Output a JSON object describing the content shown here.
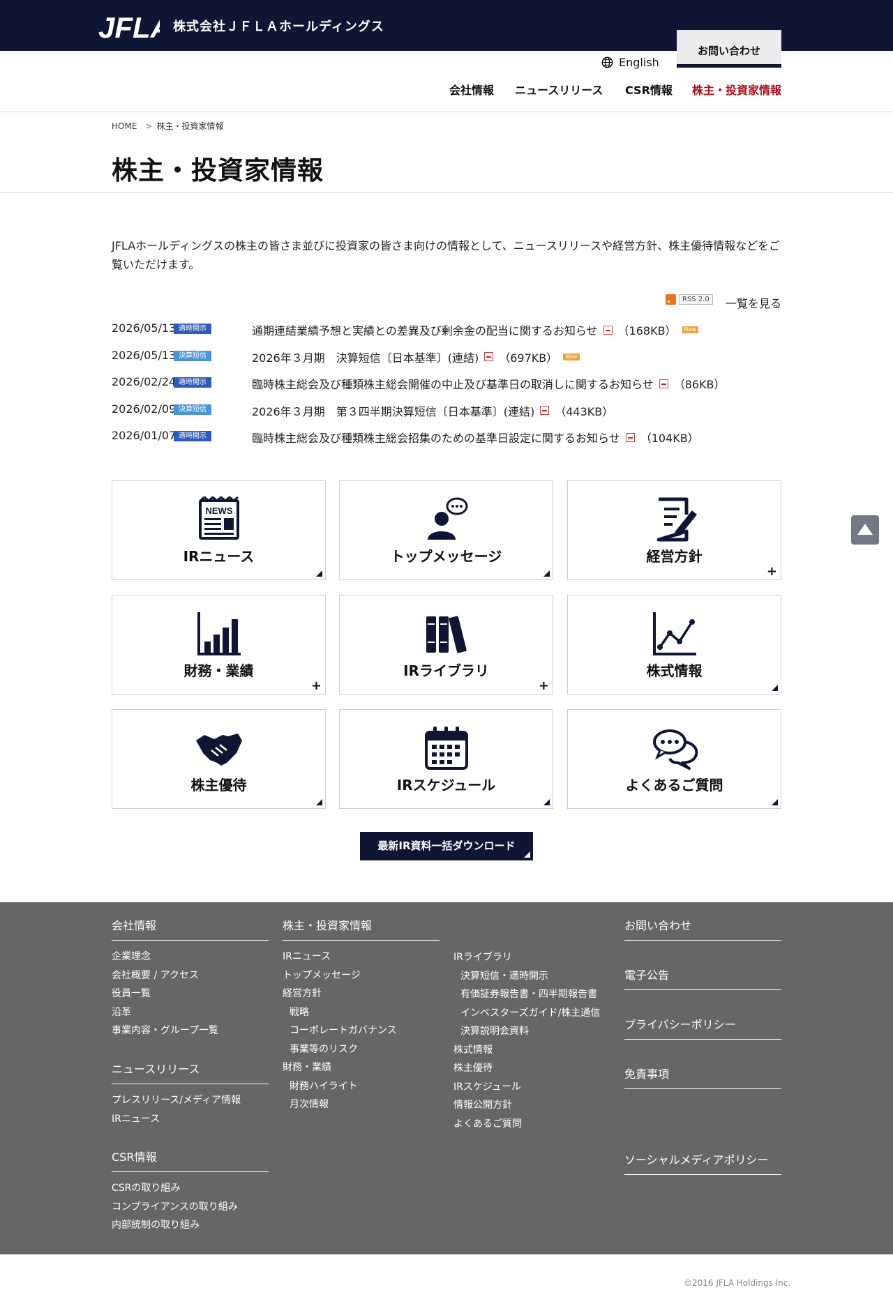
{
  "header": {
    "logo_text": "JFLA",
    "company_name": "株式会社ＪＦＬＡホールディングス",
    "contact_label": "お問い合わせ",
    "english_label": "English",
    "nav": [
      {
        "label": "会社情報",
        "active": false
      },
      {
        "label": "ニュースリリース",
        "active": false
      },
      {
        "label": "CSR情報",
        "active": false
      },
      {
        "label": "株主・投資家情報",
        "active": true
      }
    ]
  },
  "breadcrumb": {
    "home": "HOME",
    "sep": ">",
    "current": "株主・投資家情報"
  },
  "page": {
    "title": "株主・投資家情報",
    "intro": "JFLAホールディングスの株主の皆さま並びに投資家の皆さま向けの情報として、ニュースリリースや経営方針、株主優待情報などをご覧いただけます。"
  },
  "feed": {
    "rss_label": "RSS 2.0",
    "all_label": "一覧を見る"
  },
  "news": [
    {
      "date": "2026/05/13",
      "tag": "適時開示",
      "tag_color": "#2f5cb8",
      "title": "通期連結業績予想と実績との差異及び剰余金の配当に関するお知らせ",
      "size": "（168KB）",
      "new_label": "New"
    },
    {
      "date": "2026/05/13",
      "tag": "決算短信",
      "tag_color": "#4a95d6",
      "title": "2026年３月期　決算短信〔日本基準〕(連結)",
      "size": "（697KB）",
      "new_label": "New"
    },
    {
      "date": "2026/02/24",
      "tag": "適時開示",
      "tag_color": "#2f5cb8",
      "title": "臨時株主総会及び種類株主総会開催の中止及び基準日の取消しに関するお知らせ",
      "size": "（86KB）",
      "new_label": ""
    },
    {
      "date": "2026/02/09",
      "tag": "決算短信",
      "tag_color": "#4a95d6",
      "title": "2026年３月期　第３四半期決算短信〔日本基準〕(連結)",
      "size": "（443KB）",
      "new_label": ""
    },
    {
      "date": "2026/01/07",
      "tag": "適時開示",
      "tag_color": "#2f5cb8",
      "title": "臨時株主総会及び種類株主総会招集のための基準日設定に関するお知らせ",
      "size": "（104KB）",
      "new_label": ""
    }
  ],
  "tiles": [
    {
      "label": "IRニュース",
      "icon": "news-icon",
      "marker": "arrow",
      "icon_text": "NEWS"
    },
    {
      "label": "トップメッセージ",
      "icon": "speaker-icon",
      "marker": "arrow"
    },
    {
      "label": "経営方針",
      "icon": "document-pen-icon",
      "marker": "plus"
    },
    {
      "label": "財務・業績",
      "icon": "bar-chart-icon",
      "marker": "plus"
    },
    {
      "label": "IRライブラリ",
      "icon": "books-icon",
      "marker": "plus"
    },
    {
      "label": "株式情報",
      "icon": "line-chart-icon",
      "marker": "arrow"
    },
    {
      "label": "株主優待",
      "icon": "handshake-icon",
      "marker": "arrow"
    },
    {
      "label": "IRスケジュール",
      "icon": "calendar-icon",
      "marker": "arrow"
    },
    {
      "label": "よくあるご質問",
      "icon": "chat-bubbles-icon",
      "marker": "arrow"
    }
  ],
  "marker_plus": "+",
  "download_label": "最新IR資料一括ダウンロード",
  "footer": {
    "company": {
      "heading": "会社情報",
      "items": [
        "企業理念",
        "会社概要 / アクセス",
        "役員一覧",
        "沿革",
        "事業内容・グループ一覧"
      ]
    },
    "news": {
      "heading": "ニュースリリース",
      "items": [
        "プレスリリース/メディア情報",
        "IRニュース"
      ]
    },
    "csr": {
      "heading": "CSR情報",
      "items": [
        "CSRの取り組み",
        "コンプライアンスの取り組み",
        "内部統制の取り組み"
      ]
    },
    "ir": {
      "heading": "株主・投資家情報",
      "col1": [
        {
          "label": "IRニュース",
          "sub": false
        },
        {
          "label": "トップメッセージ",
          "sub": false
        },
        {
          "label": "経営方針",
          "sub": false
        },
        {
          "label": "戦略",
          "sub": true
        },
        {
          "label": "コーポレートガバナンス",
          "sub": true
        },
        {
          "label": "事業等のリスク",
          "sub": true
        },
        {
          "label": "財務・業績",
          "sub": false
        },
        {
          "label": "財務ハイライト",
          "sub": true
        },
        {
          "label": "月次情報",
          "sub": true
        }
      ],
      "col2": [
        {
          "label": "IRライブラリ",
          "sub": false
        },
        {
          "label": "決算短信・適時開示",
          "sub": true
        },
        {
          "label": "有価証券報告書・四半期報告書",
          "sub": true
        },
        {
          "label": "インベスターズガイド/株主通信",
          "sub": true
        },
        {
          "label": "決算説明会資料",
          "sub": true
        },
        {
          "label": "株式情報",
          "sub": false
        },
        {
          "label": "株主優待",
          "sub": false
        },
        {
          "label": "IRスケジュール",
          "sub": false
        },
        {
          "label": "情報公開方針",
          "sub": false
        },
        {
          "label": "よくあるご質問",
          "sub": false
        }
      ]
    },
    "right": [
      "お問い合わせ",
      "電子公告",
      "プライバシーポリシー",
      "免責事項",
      "ソーシャルメディアポリシー"
    ]
  },
  "copyright": "©2016 JFLA Holdings Inc."
}
